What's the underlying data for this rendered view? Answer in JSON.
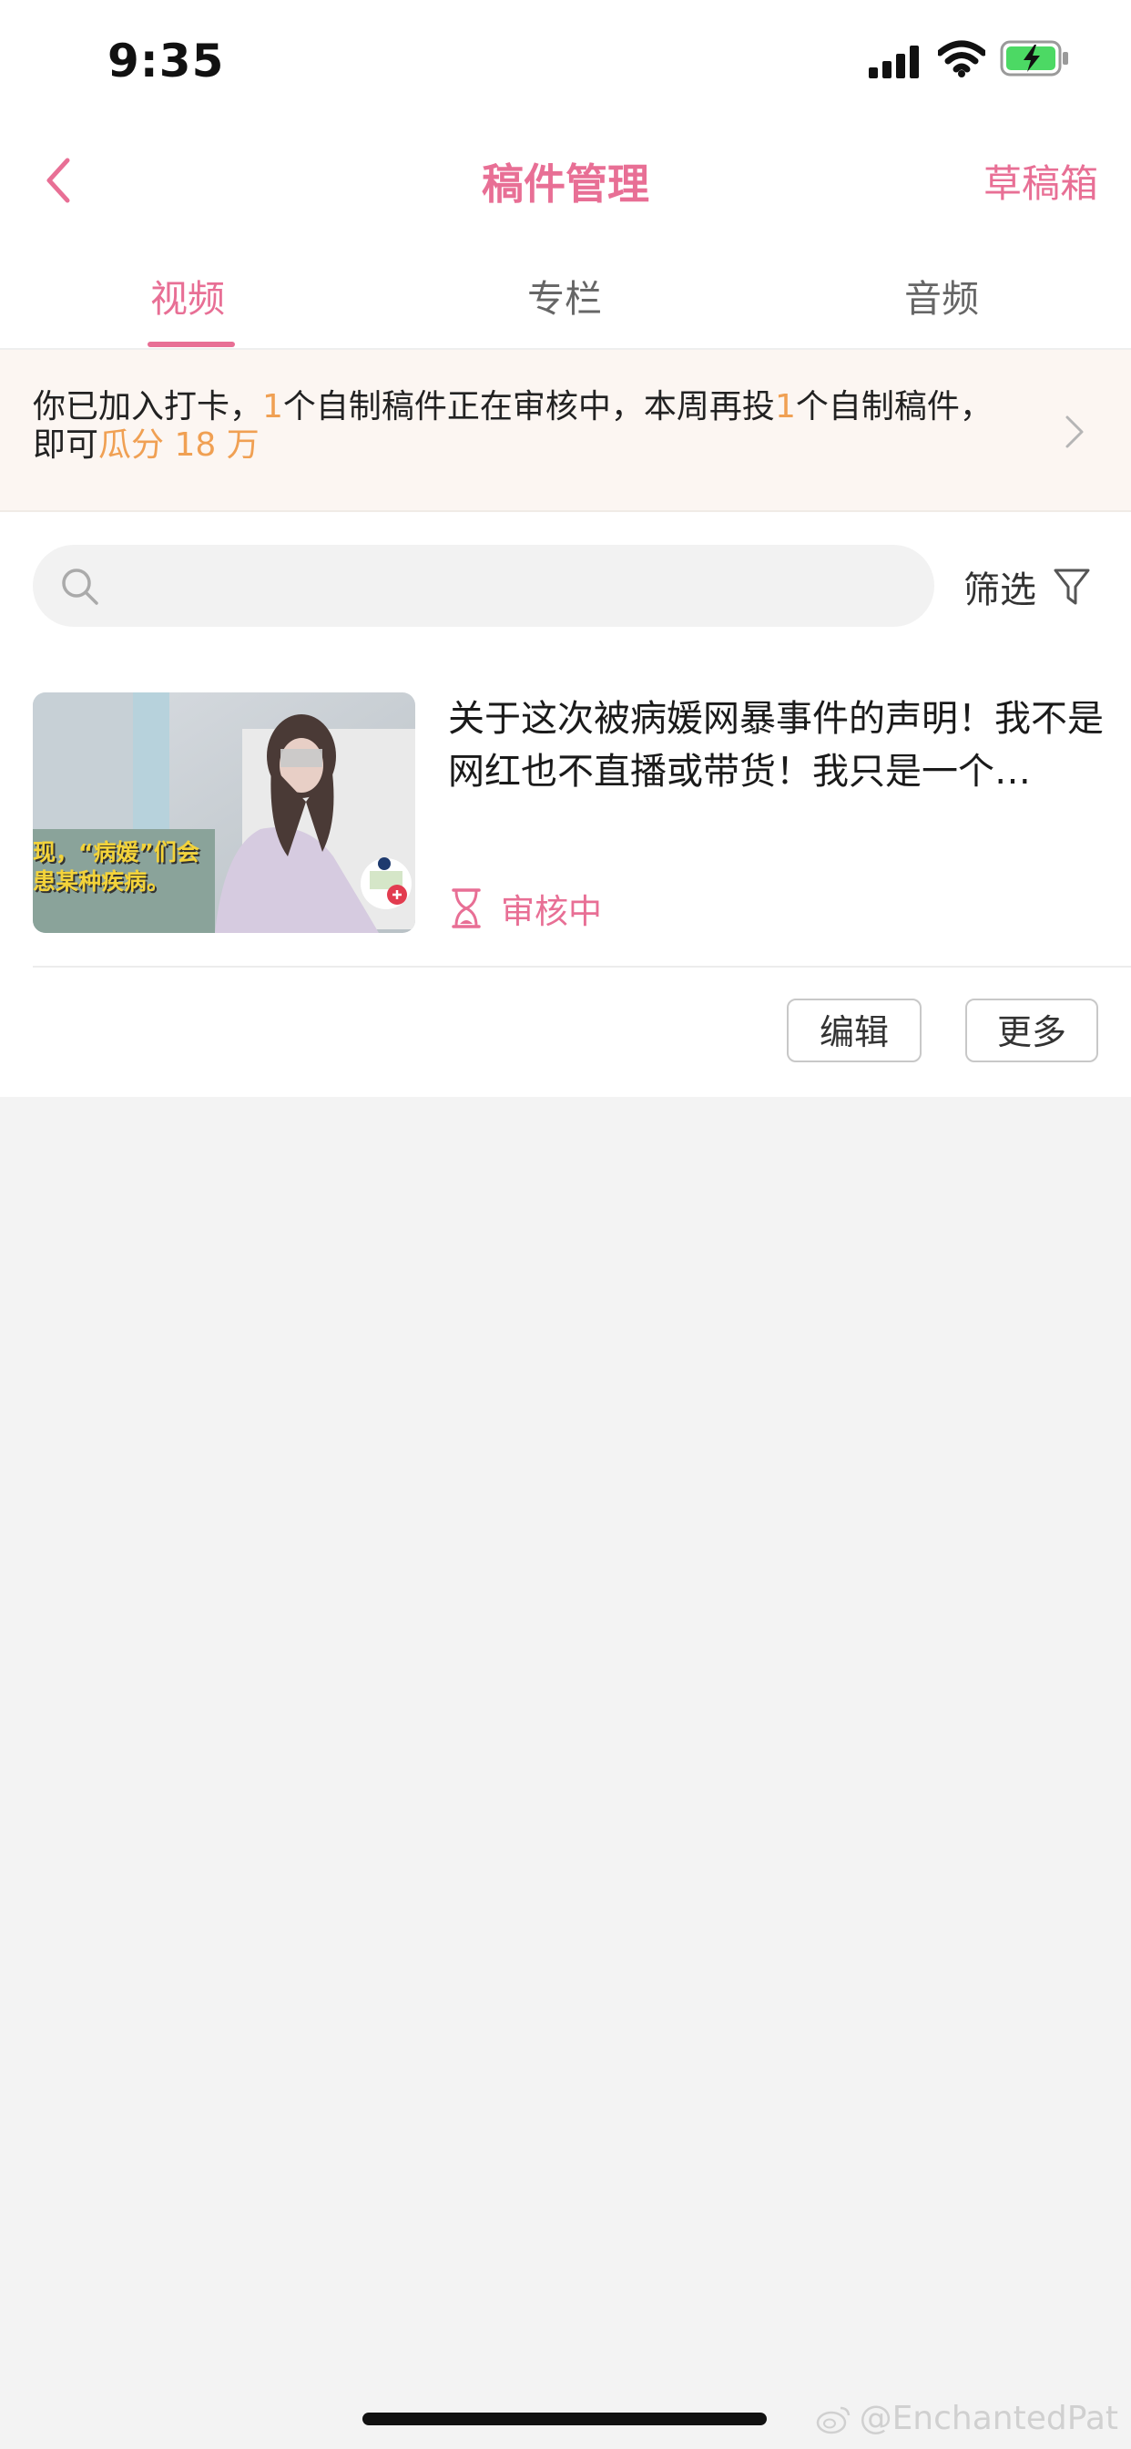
{
  "status_bar": {
    "time": "9:35"
  },
  "nav": {
    "title": "稿件管理",
    "drafts_label": "草稿箱"
  },
  "tabs": [
    {
      "label": "视频",
      "active": true
    },
    {
      "label": "专栏",
      "active": false
    },
    {
      "label": "音频",
      "active": false
    }
  ],
  "banner": {
    "part1": "你已加入打卡，",
    "num1": "1",
    "part2": "个自制稿件正在审核中，本周再投",
    "num2": "1",
    "part3": "个自制稿件，即可",
    "reward": "瓜分 18 万"
  },
  "search": {
    "placeholder": "",
    "filter_label": "筛选"
  },
  "items": [
    {
      "title": "关于这次被病媛网暴事件的声明！我不是网红也不直播或带货！我只是一个…",
      "status": "审核中",
      "thumbnail_caption_line1": "现，“病媛”们会",
      "thumbnail_caption_line2": "患某种疾病。"
    }
  ],
  "actions": {
    "edit_label": "编辑",
    "more_label": "更多"
  },
  "watermark": "@EnchantedPat",
  "colors": {
    "accent": "#e86f95",
    "highlight": "#f0a053",
    "banner_bg": "#fcf6f2",
    "page_bg": "#f3f3f3"
  }
}
